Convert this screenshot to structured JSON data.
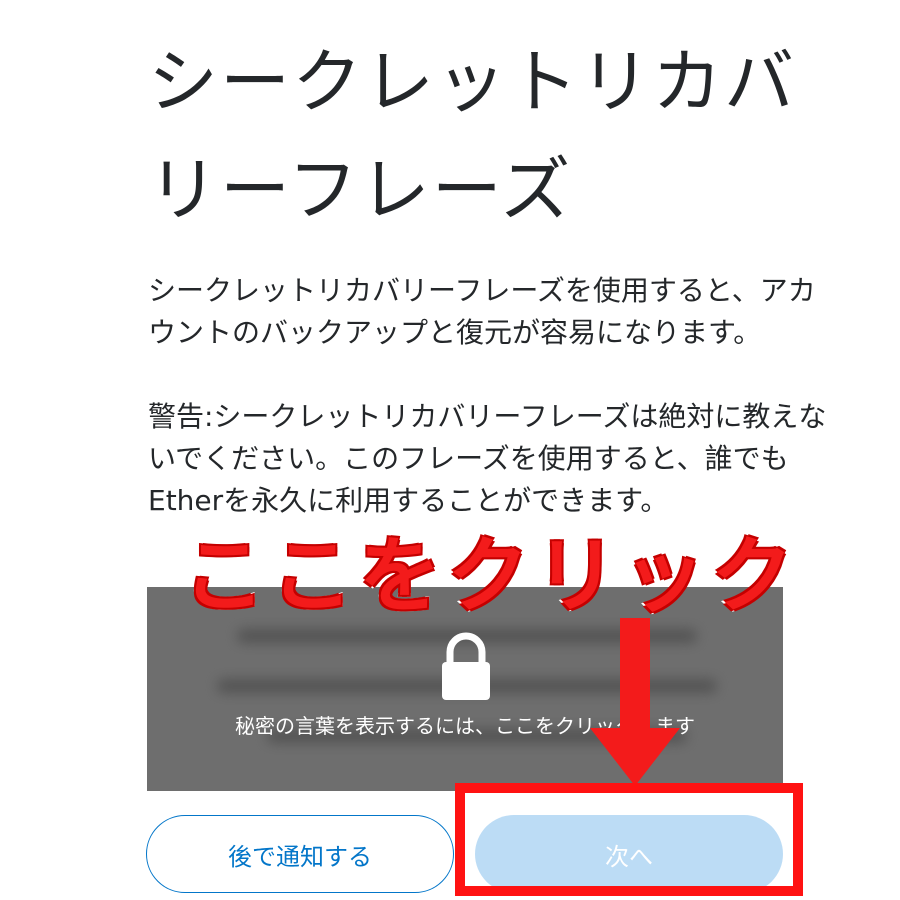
{
  "title": "シークレットリカバリーフレーズ",
  "title_lines": [
    "シークレットリカバ",
    "リーフレーズ"
  ],
  "description": [
    "シークレットリカバリーフレーズを使用すると、アカ",
    "ウントのバックアップと復元が容易になります。"
  ],
  "warning": [
    "警告:シークレットリカバリーフレーズは絶対に教えな",
    "いでください。このフレーズを使用すると、誰でも",
    "Etherを永久に利用することができます。"
  ],
  "reveal": {
    "label": "秘密の言葉を表示するには、ここをクリックします",
    "icon": "lock-icon"
  },
  "buttons": {
    "remind_later": "後で通知する",
    "next": "次へ"
  },
  "annotation": {
    "callout": "ここをクリック",
    "arrow_icon": "down-arrow-icon",
    "color": "#f31b1b"
  },
  "colors": {
    "primary": "#0376c9",
    "next_disabled_bg": "#bcdcf5",
    "reveal_bg": "#6e6e6e"
  }
}
